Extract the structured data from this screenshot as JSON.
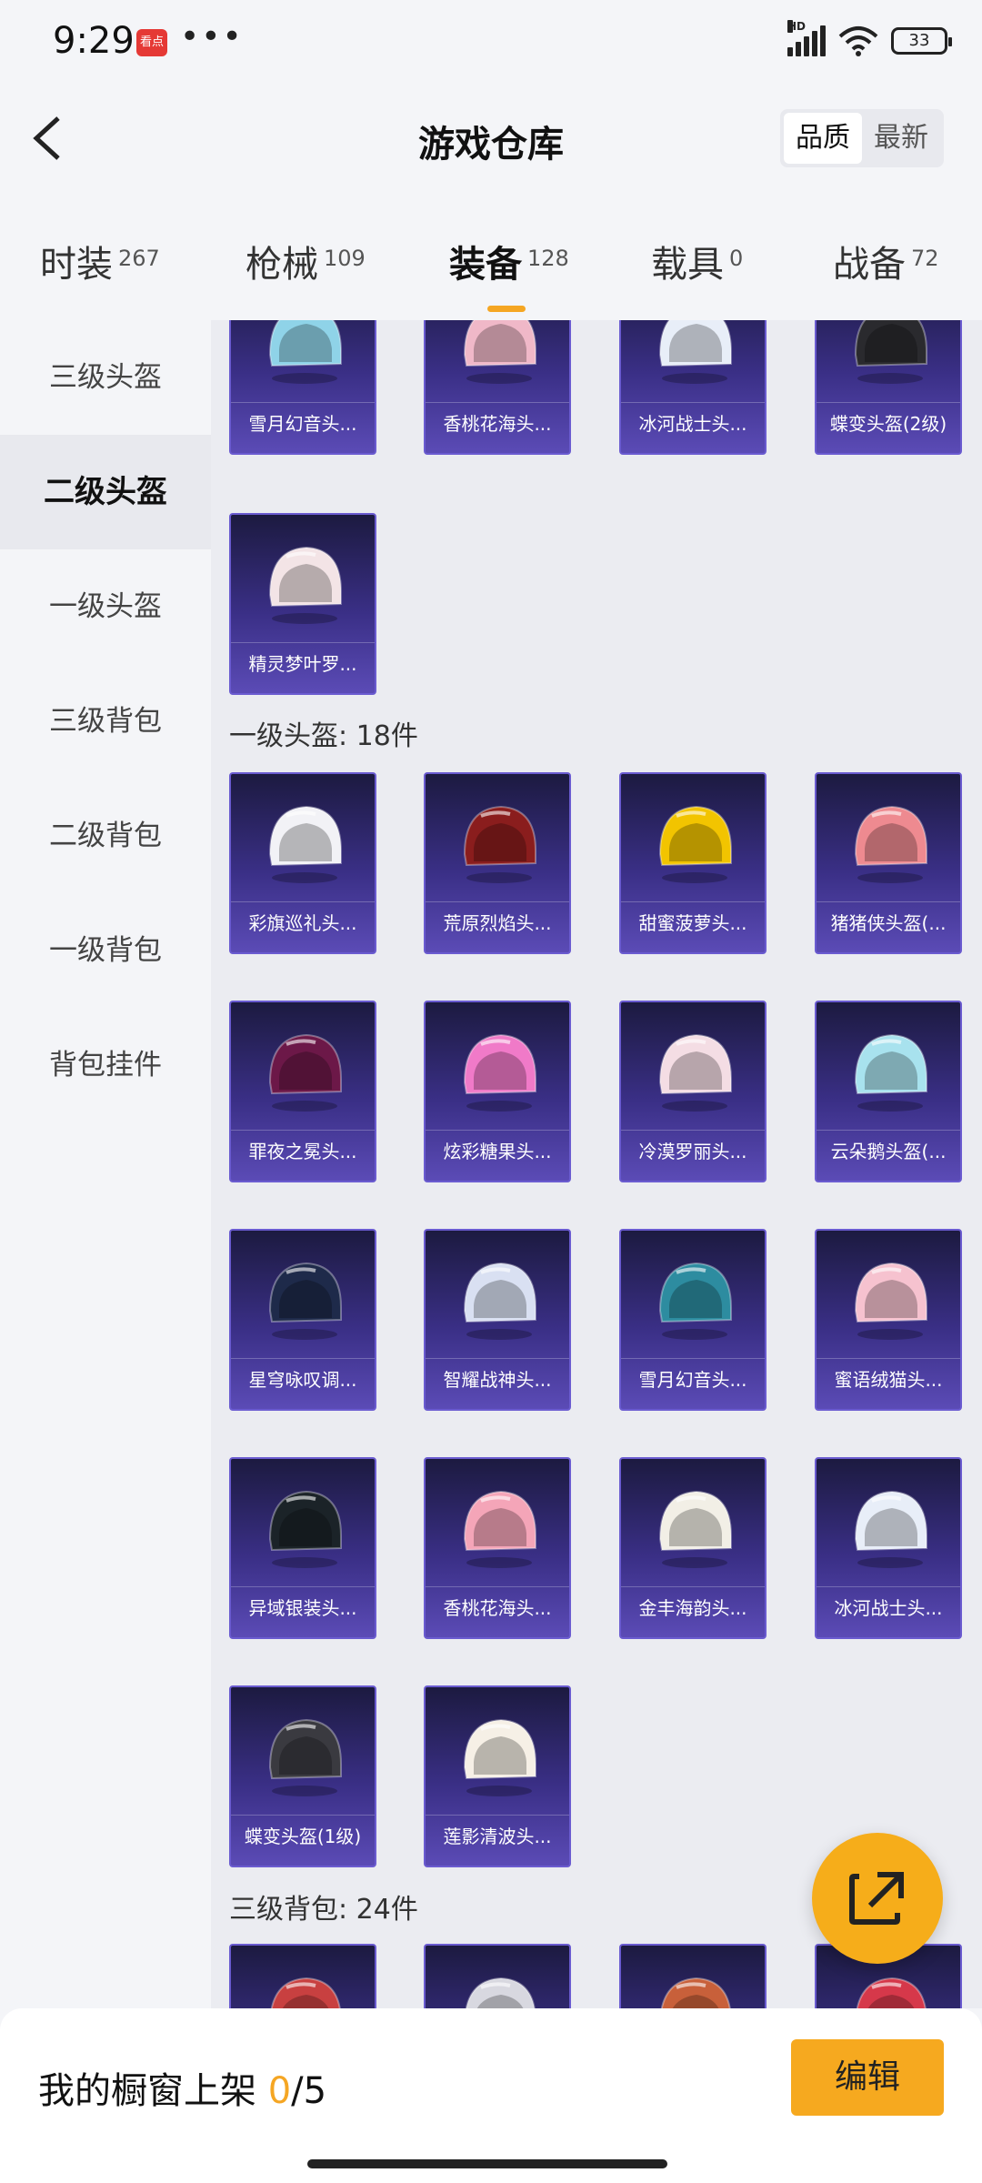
{
  "status_bar": {
    "time": "9:29",
    "app_badge": "看点",
    "dots": "•••",
    "hd": "HD",
    "battery": "33"
  },
  "header": {
    "title": "游戏仓库",
    "sort_options": [
      "品质",
      "最新"
    ],
    "active_sort": "品质"
  },
  "tabs": [
    {
      "label": "时装",
      "count": "267"
    },
    {
      "label": "枪械",
      "count": "109"
    },
    {
      "label": "装备",
      "count": "128"
    },
    {
      "label": "载具",
      "count": "0"
    },
    {
      "label": "战备",
      "count": "72"
    }
  ],
  "active_tab": "装备",
  "sidebar": {
    "items": [
      "三级头盔",
      "二级头盔",
      "一级头盔",
      "三级背包",
      "二级背包",
      "一级背包",
      "背包挂件"
    ],
    "active": "二级头盔"
  },
  "sections": {
    "level2": {
      "items": [
        {
          "name": "雪月幻音头...",
          "color": "#8fd3e8"
        },
        {
          "name": "香桃花海头...",
          "color": "#f0b8c8"
        },
        {
          "name": "冰河战士头...",
          "color": "#e8eef8"
        },
        {
          "name": "蝶变头盔(2级)",
          "color": "#2a2a2e"
        },
        {
          "name": "精灵梦叶罗...",
          "color": "#f3e4e6"
        }
      ]
    },
    "level1": {
      "title": "一级头盔: 18件",
      "items": [
        {
          "name": "彩旗巡礼头...",
          "color": "#f2f2f6"
        },
        {
          "name": "荒原烈焰头...",
          "color": "#8a1d1d"
        },
        {
          "name": "甜蜜菠萝头...",
          "color": "#f2c400"
        },
        {
          "name": "猪猪侠头盔(...",
          "color": "#ee8a90"
        },
        {
          "name": "罪夜之冕头...",
          "color": "#6c1848"
        },
        {
          "name": "炫彩糖果头...",
          "color": "#f07ac8"
        },
        {
          "name": "冷漠罗丽头...",
          "color": "#f4dde4"
        },
        {
          "name": "云朵鹅头盔(...",
          "color": "#a8e2ee"
        },
        {
          "name": "星穹咏叹调...",
          "color": "#1e2a4a"
        },
        {
          "name": "智耀战神头...",
          "color": "#d9e0f2"
        },
        {
          "name": "雪月幻音头...",
          "color": "#2d8ca0"
        },
        {
          "name": "蜜语绒猫头...",
          "color": "#f6c2cf"
        },
        {
          "name": "异域银装头...",
          "color": "#1b2328"
        },
        {
          "name": "香桃花海头...",
          "color": "#f4a5b8"
        },
        {
          "name": "金丰海韵头...",
          "color": "#f2efe6"
        },
        {
          "name": "冰河战士头...",
          "color": "#e8eef8"
        },
        {
          "name": "蝶变头盔(1级)",
          "color": "#3a3a40"
        },
        {
          "name": "莲影清波头...",
          "color": "#f6f0e6"
        }
      ]
    },
    "backpack3": {
      "title": "三级背包: 24件",
      "items": [
        {
          "name": "",
          "color": "#c84040"
        },
        {
          "name": "",
          "color": "#d8d8e0"
        },
        {
          "name": "",
          "color": "#c8603a"
        },
        {
          "name": "",
          "color": "#d6384a"
        }
      ]
    }
  },
  "bottom": {
    "label": "我的橱窗上架 ",
    "current": "0",
    "total": "/5",
    "edit": "编辑"
  },
  "colors": {
    "accent": "#f6ad1a",
    "card_top": "#1c1a40",
    "card_bottom": "#5b4bb6"
  }
}
